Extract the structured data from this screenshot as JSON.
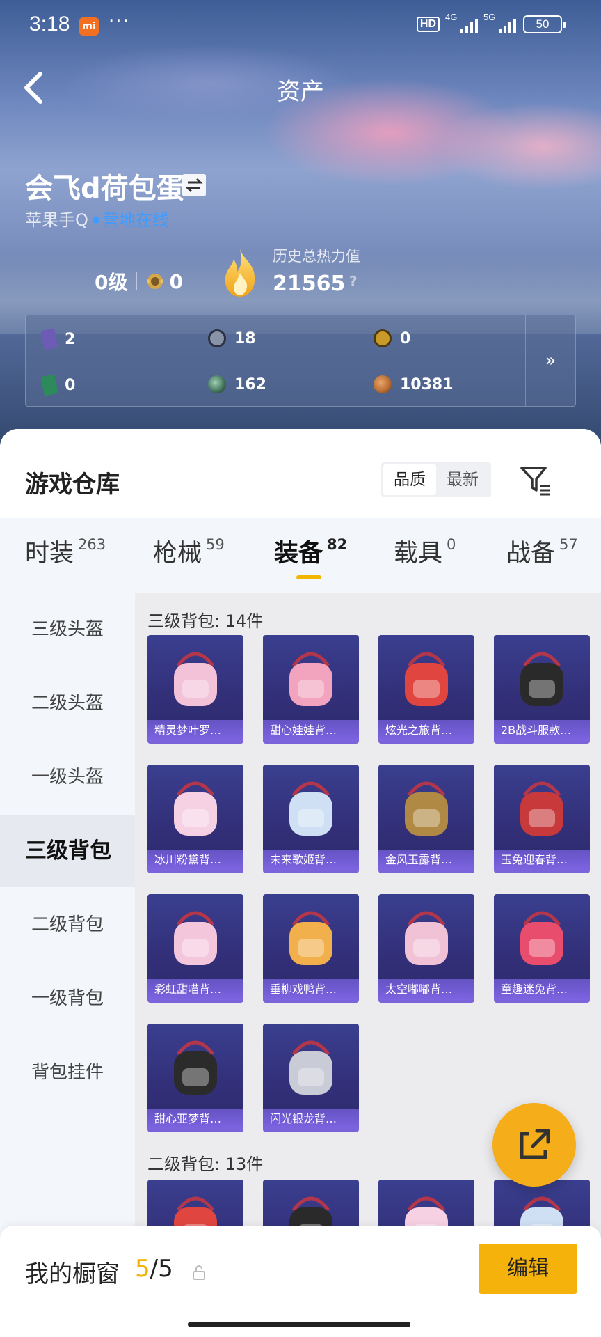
{
  "status_bar": {
    "time": "3:18",
    "network_hd": "HD",
    "net1": "4G",
    "net2": "5G",
    "battery": "50"
  },
  "header": {
    "title": "资产"
  },
  "user": {
    "name": "会飞d荷包蛋",
    "platform": "苹果手Q",
    "online_status": "营地在线"
  },
  "stats": {
    "level": "0级",
    "rank_points": "0",
    "heat_label": "历史总热力值",
    "heat_value": "21565",
    "heat_help": "?"
  },
  "assets": [
    {
      "icon": "purple-card-icon",
      "value": "2",
      "color": "#6d5bb6"
    },
    {
      "icon": "silver-coin-icon",
      "value": "18",
      "color": "#8893a8"
    },
    {
      "icon": "gold-coin-icon",
      "value": "0",
      "color": "#c99a2a"
    },
    {
      "icon": "green-card-icon",
      "value": "0",
      "color": "#2d8a5a"
    },
    {
      "icon": "green-orb-icon",
      "value": "162",
      "color": "#3f6e58"
    },
    {
      "icon": "bronze-coin-icon",
      "value": "10381",
      "color": "#b66a30"
    }
  ],
  "assets_more": "»",
  "warehouse": {
    "title": "游戏仓库",
    "sort_options": [
      "品质",
      "最新"
    ],
    "active_sort": "品质"
  },
  "tabs": [
    {
      "label": "时装",
      "count": "263"
    },
    {
      "label": "枪械",
      "count": "59"
    },
    {
      "label": "装备",
      "count": "82"
    },
    {
      "label": "载具",
      "count": "0"
    },
    {
      "label": "战备",
      "count": "57"
    }
  ],
  "active_tab": "装备",
  "sidebar": [
    "三级头盔",
    "二级头盔",
    "一级头盔",
    "三级背包",
    "二级背包",
    "一级背包",
    "背包挂件"
  ],
  "active_sidebar": "三级背包",
  "sections": [
    {
      "title": "三级背包: 14件",
      "items": [
        "精灵梦叶罗…",
        "甜心娃娃背…",
        "炫光之旅背…",
        "2B战斗服款…",
        "冰川粉黛背…",
        "未来歌姬背…",
        "金风玉露背…",
        "玉兔迎春背…",
        "彩虹甜喵背…",
        "垂柳戏鸭背…",
        "太空嘟嘟背…",
        "童趣迷兔背…",
        "甜心亚梦背…",
        "闪光银龙背…"
      ]
    },
    {
      "title": "二级背包: 13件",
      "items": []
    }
  ],
  "showcase": {
    "label": "我的橱窗",
    "current": "5",
    "separator": "/",
    "total": "5",
    "edit_label": "编辑"
  },
  "colors": {
    "accent": "#f5b20a",
    "link": "#3f9cff",
    "card_bg": "#33307a",
    "card_label": "#7b63d9"
  }
}
